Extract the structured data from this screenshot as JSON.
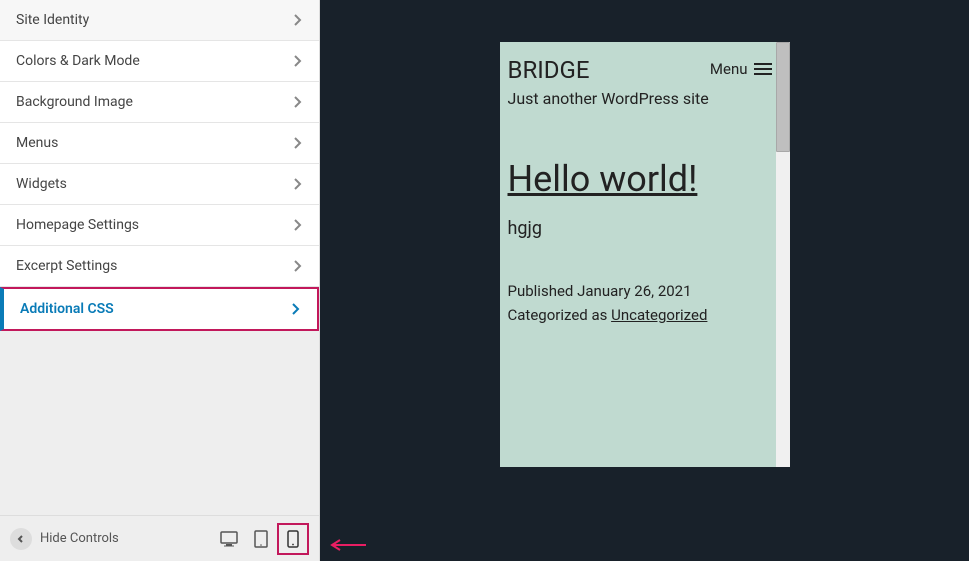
{
  "sidebar": {
    "items": [
      {
        "label": "Site Identity"
      },
      {
        "label": "Colors & Dark Mode"
      },
      {
        "label": "Background Image"
      },
      {
        "label": "Menus"
      },
      {
        "label": "Widgets"
      },
      {
        "label": "Homepage Settings"
      },
      {
        "label": "Excerpt Settings"
      },
      {
        "label": "Additional CSS"
      }
    ]
  },
  "footer": {
    "hide_controls": "Hide Controls"
  },
  "preview": {
    "site_title": "BRIDGE",
    "tagline": "Just another WordPress site",
    "menu_label": "Menu",
    "post_title": "Hello world!",
    "post_content": "hgjg",
    "published_label": "Published",
    "published_date": "January 26, 2021",
    "categorized_label": "Categorized as",
    "category": "Uncategorized"
  }
}
